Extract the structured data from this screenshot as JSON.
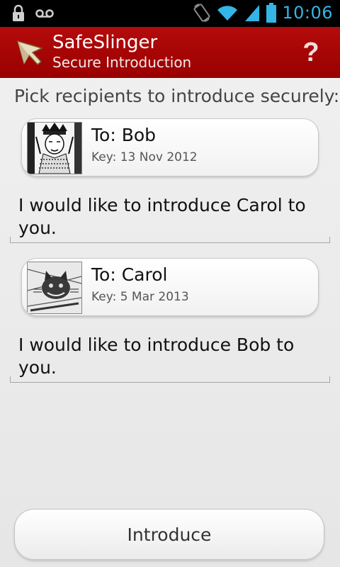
{
  "status_bar": {
    "time": "10:06",
    "left_icons": [
      "lock-icon",
      "voicemail-icon"
    ],
    "right_icons": [
      "screen-rotation-icon",
      "wifi-icon",
      "signal-icon",
      "battery-icon"
    ],
    "accent_color": "#33b5e5"
  },
  "action_bar": {
    "title": "SafeSlinger",
    "subtitle": "Secure Introduction",
    "help_label": "?",
    "background_color": "#a80505"
  },
  "main": {
    "instruction": "Pick recipients to introduce securely:",
    "recipients": [
      {
        "to": "To: Bob",
        "key": "Key: 13 Nov 2012",
        "photo": "king-portrait-photo",
        "message": "I would like to introduce Carol to you."
      },
      {
        "to": "To: Carol",
        "key": "Key: 5 Mar 2013",
        "photo": "cheshire-cat-photo",
        "message": "I would like to introduce Bob to you."
      }
    ],
    "introduce_label": "Introduce"
  }
}
